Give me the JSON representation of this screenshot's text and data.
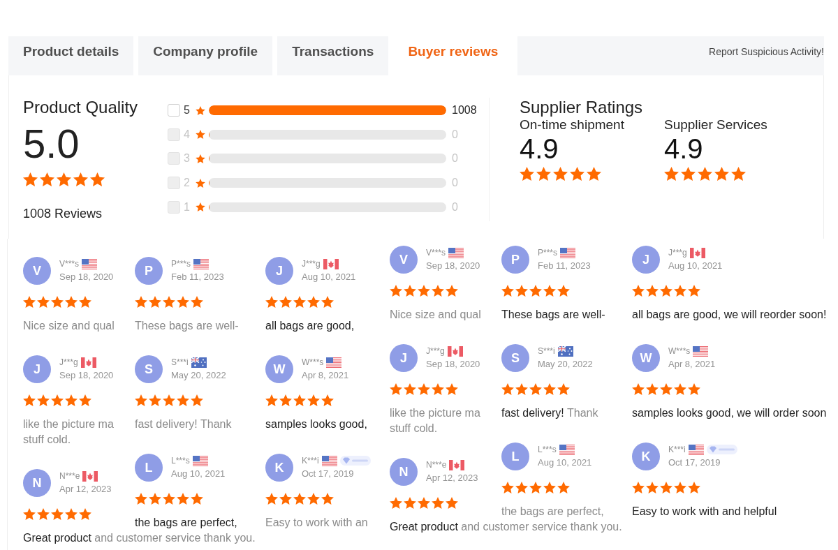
{
  "tabs": [
    {
      "label": "Product details",
      "selected": false
    },
    {
      "label": "Company profile",
      "selected": false
    },
    {
      "label": "Transactions",
      "selected": false
    },
    {
      "label": "Buyer reviews",
      "selected": true
    }
  ],
  "report_link": "Report Suspicious Activity!",
  "product_quality": {
    "title": "Product Quality",
    "score": "5.0",
    "stars": 5,
    "reviews_count": "1008 Reviews"
  },
  "rating_breakdown": [
    {
      "rating": "5",
      "checked": false,
      "disabled": false,
      "level": 1,
      "count": "1008"
    },
    {
      "rating": "4",
      "checked": false,
      "disabled": true,
      "level": 0,
      "count": "0"
    },
    {
      "rating": "3",
      "checked": false,
      "disabled": true,
      "level": 0,
      "count": "0"
    },
    {
      "rating": "2",
      "checked": false,
      "disabled": true,
      "level": 0,
      "count": "0"
    },
    {
      "rating": "1",
      "checked": false,
      "disabled": true,
      "level": 0,
      "count": "0"
    }
  ],
  "supplier_ratings": {
    "title": "Supplier Ratings",
    "items": [
      {
        "label": "On-time shipment",
        "score": "4.9",
        "stars": 5
      },
      {
        "label": "Supplier Services",
        "score": "4.9",
        "stars": 5
      }
    ]
  },
  "review_panels": [
    {
      "columns": [
        {
          "reviews": [
            {
              "avatar": "V",
              "name": "V***s",
              "flag": {
                "kind": "us"
              },
              "badge": false,
              "date": "Sep 18, 2020",
              "stars": 5,
              "segments": [
                {
                  "text": "Nice size and qual",
                  "blurred": true
                }
              ]
            },
            {
              "avatar": "J",
              "name": "J***g",
              "flag": {
                "kind": "ca"
              },
              "badge": false,
              "date": "Sep 18, 2020",
              "stars": 5,
              "segments": [
                {
                  "text": "like the picture ma\nstuff cold.",
                  "blurred": true
                }
              ]
            },
            {
              "avatar": "N",
              "name": "N***e",
              "flag": {
                "kind": "ca"
              },
              "badge": false,
              "date": "Apr 12, 2023",
              "stars": 5,
              "segments": [
                {
                  "text": "Great product",
                  "blurred": false
                },
                {
                  "text": "and customer service thank you.",
                  "blurred": true
                }
              ]
            }
          ]
        },
        {
          "reviews": [
            {
              "avatar": "P",
              "name": "P***s",
              "flag": {
                "kind": "us"
              },
              "badge": false,
              "date": "Feb 11, 2023",
              "stars": 5,
              "segments": [
                {
                  "text": "These bags are well-",
                  "blurred": true
                }
              ]
            },
            {
              "avatar": "S",
              "name": "S***i",
              "flag": {
                "kind": "au"
              },
              "badge": false,
              "date": "May 20, 2022",
              "stars": 5,
              "segments": [
                {
                  "text": "fast delivery! Thank",
                  "blurred": true
                }
              ]
            },
            {
              "avatar": "L",
              "name": "L***s",
              "flag": {
                "kind": "us"
              },
              "badge": false,
              "date": "Aug 10, 2021",
              "stars": 5,
              "segments": [
                {
                  "text": "the bags are perfect,",
                  "blurred": false
                }
              ]
            }
          ]
        },
        {
          "reviews": [
            {
              "avatar": "J",
              "name": "J***g",
              "flag": {
                "kind": "ca"
              },
              "badge": false,
              "date": "Aug 10, 2021",
              "stars": 5,
              "segments": [
                {
                  "text": "all bags are good,",
                  "blurred": false
                }
              ]
            },
            {
              "avatar": "W",
              "name": "W***s",
              "flag": {
                "kind": "us"
              },
              "badge": false,
              "date": "Apr 8, 2021",
              "stars": 5,
              "segments": [
                {
                  "text": "samples looks good,",
                  "blurred": false
                }
              ]
            },
            {
              "avatar": "K",
              "name": "K***i",
              "flag": {
                "kind": "us"
              },
              "badge": true,
              "date": "Oct 17, 2019",
              "stars": 5,
              "segments": [
                {
                  "text": "Easy to work with an",
                  "blurred": true
                }
              ]
            }
          ]
        }
      ]
    },
    {
      "columns": [
        {
          "reviews": [
            {
              "avatar": "V",
              "name": "V***s",
              "flag": {
                "kind": "us"
              },
              "badge": false,
              "date": "Sep 18, 2020",
              "stars": 5,
              "segments": [
                {
                  "text": "Nice size and qual",
                  "blurred": true
                }
              ]
            },
            {
              "avatar": "J",
              "name": "J***g",
              "flag": {
                "kind": "ca"
              },
              "badge": false,
              "date": "Sep 18, 2020",
              "stars": 5,
              "segments": [
                {
                  "text": "like the picture ma\nstuff cold.",
                  "blurred": true
                }
              ]
            },
            {
              "avatar": "N",
              "name": "N***e",
              "flag": {
                "kind": "ca"
              },
              "badge": false,
              "date": "Apr 12, 2023",
              "stars": 5,
              "segments": [
                {
                  "text": "Great product",
                  "blurred": false
                },
                {
                  "text": "and customer service thank you.",
                  "blurred": true
                }
              ]
            }
          ]
        },
        {
          "reviews": [
            {
              "avatar": "P",
              "name": "P***s",
              "flag": {
                "kind": "us"
              },
              "badge": false,
              "date": "Feb 11, 2023",
              "stars": 5,
              "segments": [
                {
                  "text": "These bags are well-",
                  "blurred": false
                }
              ]
            },
            {
              "avatar": "S",
              "name": "S***i",
              "flag": {
                "kind": "au"
              },
              "badge": false,
              "date": "May 20, 2022",
              "stars": 5,
              "segments": [
                {
                  "text": "fast delivery!",
                  "blurred": false
                },
                {
                  "text": "Thank",
                  "blurred": true
                }
              ]
            },
            {
              "avatar": "L",
              "name": "L***s",
              "flag": {
                "kind": "us"
              },
              "badge": false,
              "date": "Aug 10, 2021",
              "stars": 5,
              "segments": [
                {
                  "text": "the bags are perfect,",
                  "blurred": true
                }
              ]
            }
          ]
        },
        {
          "reviews": [
            {
              "avatar": "J",
              "name": "J***g",
              "flag": {
                "kind": "ca"
              },
              "badge": false,
              "date": "Aug 10, 2021",
              "stars": 5,
              "segments": [
                {
                  "text": "all bags are good, we will reorder soon!",
                  "blurred": false
                }
              ]
            },
            {
              "avatar": "W",
              "name": "W***s",
              "flag": {
                "kind": "us"
              },
              "badge": false,
              "date": "Apr 8, 2021",
              "stars": 5,
              "segments": [
                {
                  "text": "samples looks good, we will order soon",
                  "blurred": false
                }
              ]
            },
            {
              "avatar": "K",
              "name": "K***i",
              "flag": {
                "kind": "us"
              },
              "badge": true,
              "date": "Oct 17, 2019",
              "stars": 5,
              "segments": [
                {
                  "text": "Easy to work with and helpful",
                  "blurred": false
                }
              ]
            }
          ]
        }
      ]
    }
  ]
}
